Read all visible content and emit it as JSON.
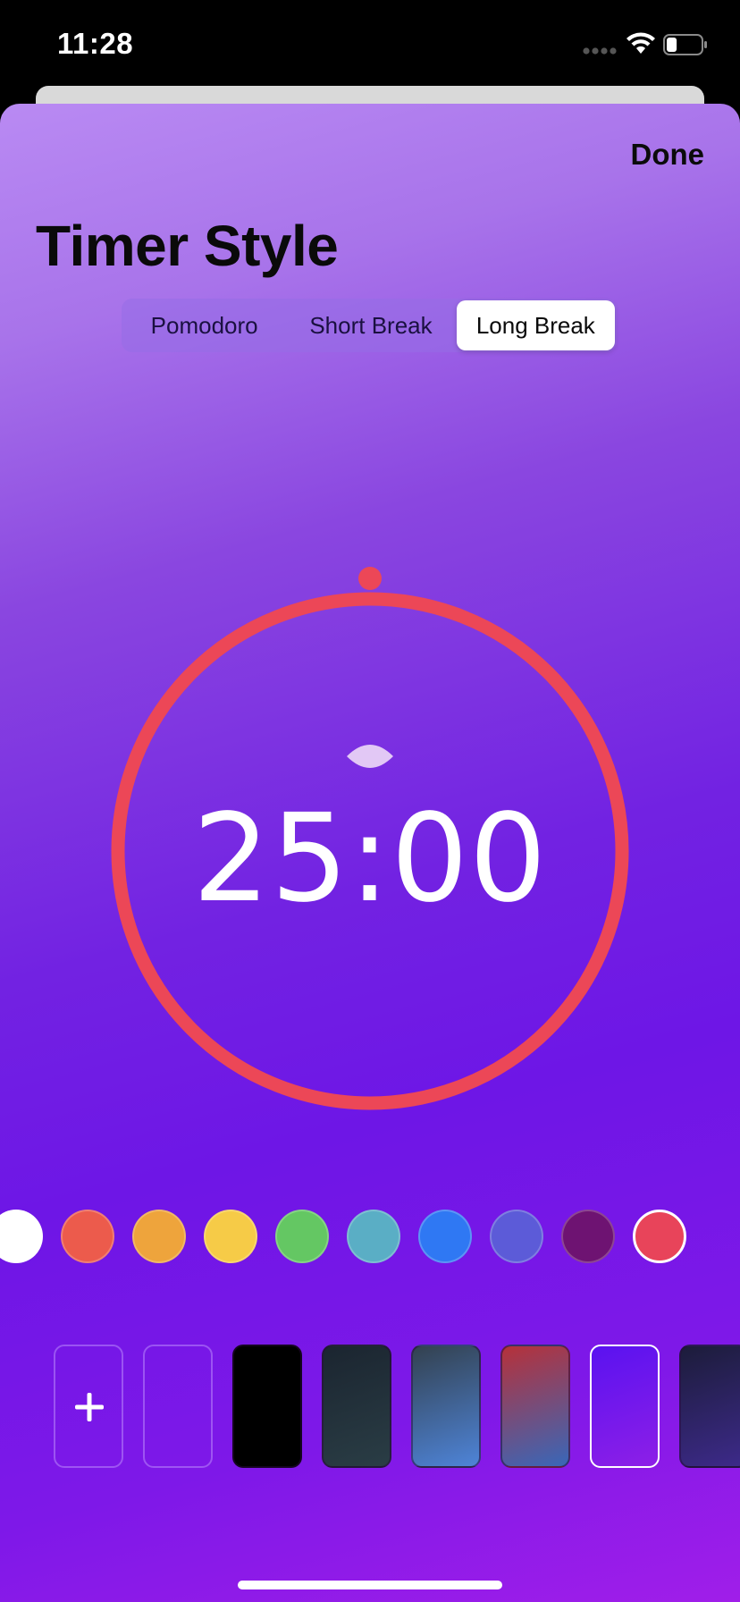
{
  "status_bar": {
    "time": "11:28",
    "battery_level": 0.3
  },
  "header": {
    "done_label": "Done",
    "title": "Timer Style"
  },
  "segmented_control": {
    "options": [
      "Pomodoro",
      "Short Break",
      "Long Break"
    ],
    "selected": "Long Break"
  },
  "timer": {
    "display": "25:00",
    "ring_color": "#ec4757",
    "progress": 1.0,
    "center_icon": "lens-icon"
  },
  "color_swatches": [
    {
      "name": "white",
      "color": "#ffffff"
    },
    {
      "name": "red",
      "color": "#ec5b4c"
    },
    {
      "name": "orange",
      "color": "#eea43c"
    },
    {
      "name": "yellow",
      "color": "#f6cb47"
    },
    {
      "name": "green",
      "color": "#64c763"
    },
    {
      "name": "teal",
      "color": "#5aaec5"
    },
    {
      "name": "blue",
      "color": "#2f78f3"
    },
    {
      "name": "indigo",
      "color": "#5c5bd8"
    },
    {
      "name": "plum",
      "color": "#6e1372"
    },
    {
      "name": "pink-red",
      "color": "#e8445a",
      "selected": true
    }
  ],
  "background_tiles": [
    {
      "name": "add",
      "icon": "plus-icon"
    },
    {
      "name": "clear"
    },
    {
      "name": "black",
      "background": "#000000"
    },
    {
      "name": "dark-slate",
      "background": "linear-gradient(160deg, #1b2530, #2a3d45)"
    },
    {
      "name": "slate-blue",
      "background": "linear-gradient(160deg, #33414f, #4e84d8)"
    },
    {
      "name": "red-blue",
      "background": "linear-gradient(160deg, #b6313a, #3967b8)"
    },
    {
      "name": "violet",
      "background": "linear-gradient(160deg, #5a12f0, #8d1fe7)",
      "selected": true
    },
    {
      "name": "midnight",
      "background": "linear-gradient(160deg, #1c1c3a, #3d2a8a)"
    }
  ]
}
